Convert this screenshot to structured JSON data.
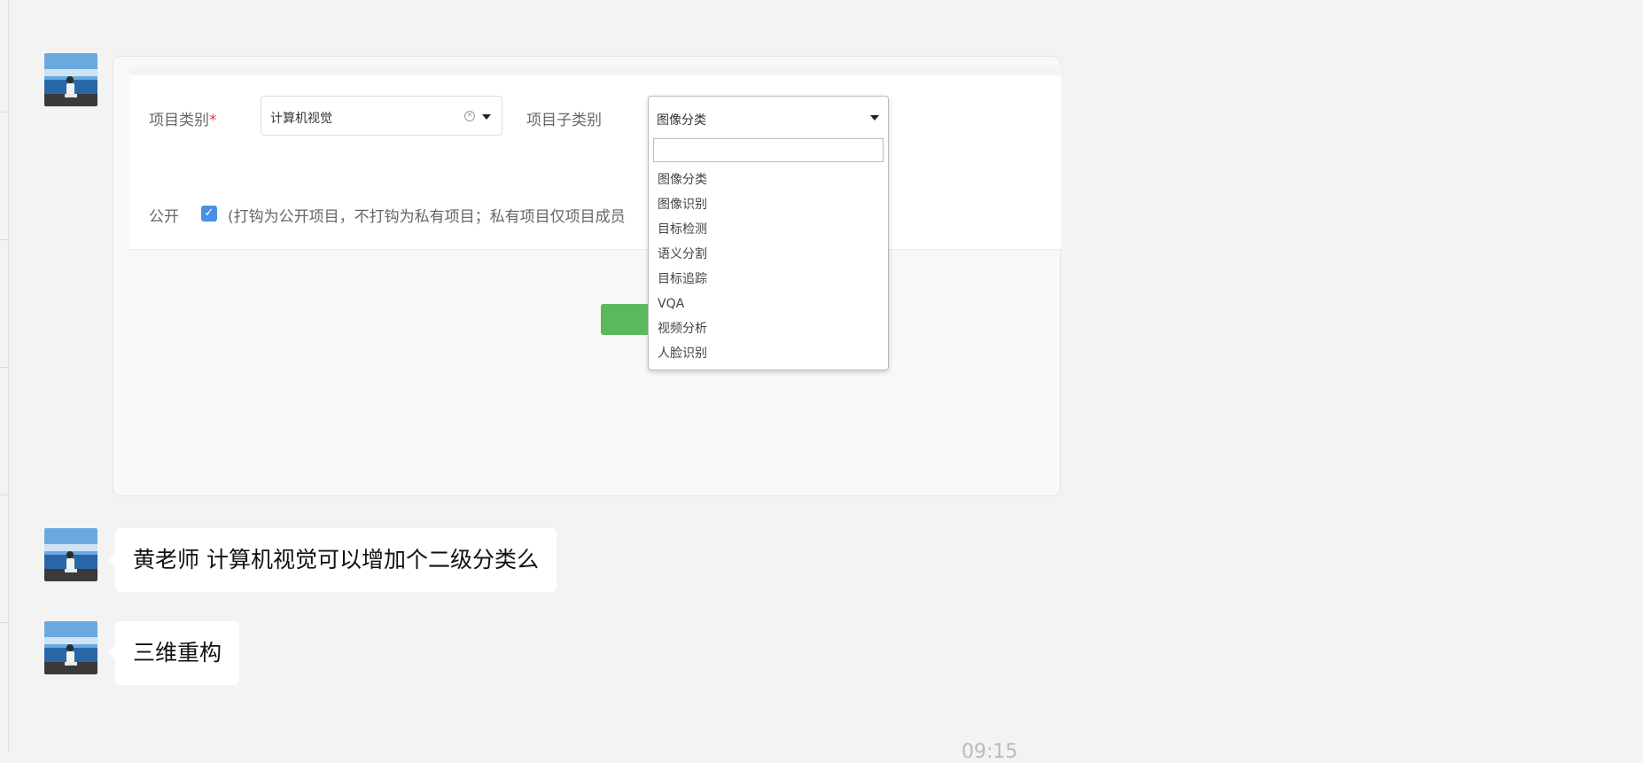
{
  "form": {
    "category_label": "项目类别",
    "required_mark": "*",
    "category_value": "计算机视觉",
    "subcategory_label": "项目子类别",
    "subcategory_value": "图像分类",
    "public_label": "公开",
    "public_checked": true,
    "public_hint": "(打钩为公开项目，不打钩为私有项目；私有项目仅项目成员"
  },
  "dropdown": {
    "search_value": "",
    "options": [
      "图像分类",
      "图像识别",
      "目标检测",
      "语义分割",
      "目标追踪",
      "VQA",
      "视频分析",
      "人脸识别"
    ]
  },
  "messages": [
    {
      "text": "黄老师 计算机视觉可以增加个二级分类么"
    },
    {
      "text": "三维重构"
    }
  ],
  "timestamp": "09:15",
  "colors": {
    "background": "#f3f3f3",
    "checkbox": "#4a90e2",
    "submit_button": "#5cb85c",
    "required": "#e4393c"
  },
  "icons": {
    "avatar": "avatar-person-by-sea",
    "clear": "clear-circle-icon",
    "caret": "caret-down-icon",
    "check": "checkbox-check-icon"
  }
}
